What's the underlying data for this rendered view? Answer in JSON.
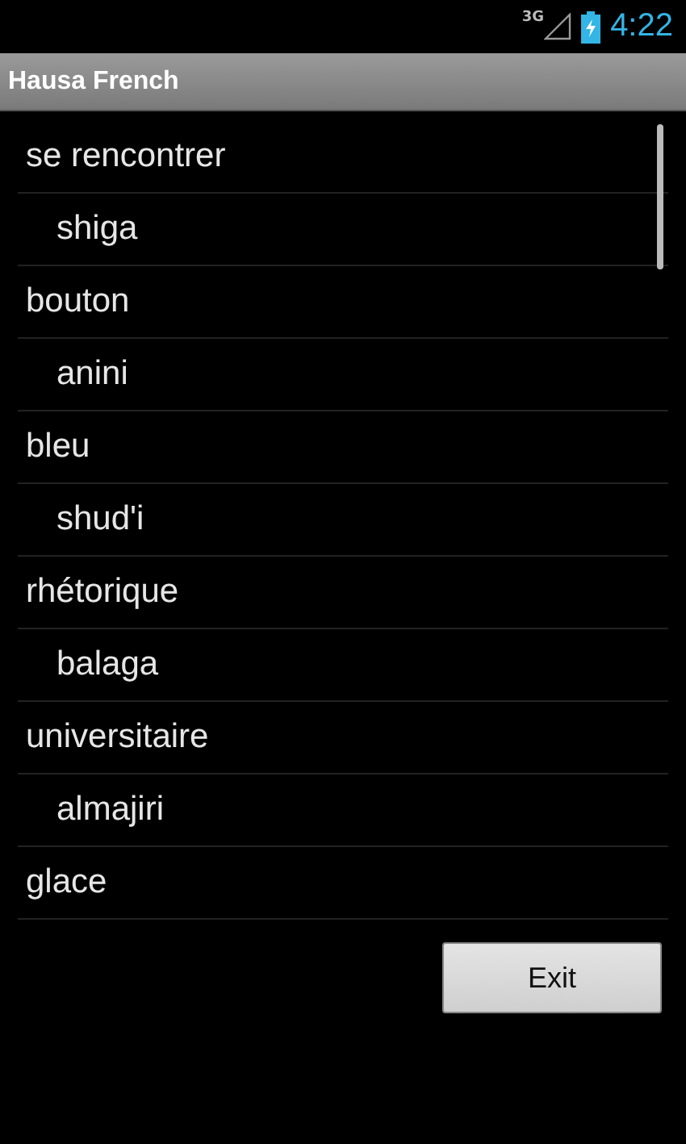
{
  "status_bar": {
    "network": "3G",
    "time": "4:22"
  },
  "title_bar": {
    "title": "Hausa French"
  },
  "list": [
    {
      "kind": "term",
      "text": "se rencontrer"
    },
    {
      "kind": "translation",
      "text": "shiga"
    },
    {
      "kind": "term",
      "text": "bouton"
    },
    {
      "kind": "translation",
      "text": "anini"
    },
    {
      "kind": "term",
      "text": "bleu"
    },
    {
      "kind": "translation",
      "text": "shud'i"
    },
    {
      "kind": "term",
      "text": "rhétorique"
    },
    {
      "kind": "translation",
      "text": "balaga"
    },
    {
      "kind": "term",
      "text": "universitaire"
    },
    {
      "kind": "translation",
      "text": "almajiri"
    },
    {
      "kind": "term",
      "text": "glace"
    }
  ],
  "buttons": [
    "Exit"
  ]
}
